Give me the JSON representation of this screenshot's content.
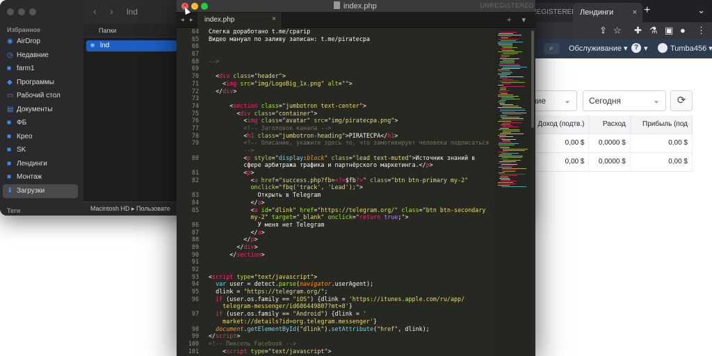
{
  "browser": {
    "tabs": [
      {
        "label": "UNREGISTERED"
      },
      {
        "label": "Лендинги"
      }
    ],
    "new_tab": "+",
    "nav": {
      "search_icon": "search-icon",
      "menu_service": "Обслуживание ▾",
      "help": "?",
      "help_caret": "▾",
      "user": "Tumba456 ▾"
    },
    "filter_period_partial": "ние",
    "filter_date": "Сегодня",
    "refresh_glyph": "⟳",
    "table": {
      "headers": [
        "Доход (подтв.)",
        "Расход",
        "Прибыль (под"
      ],
      "rows": [
        [
          "0,00 $",
          "0,0000 $",
          "0,00 $"
        ],
        [
          "0,00 $",
          "0,0000 $",
          "0,00 $"
        ]
      ]
    }
  },
  "finder": {
    "title": "lnd",
    "sidebar_heading": "Избранное",
    "sidebar_items": [
      "AirDrop",
      "Недавние",
      "farm1",
      "Программы",
      "Рабочий стол",
      "Документы",
      "ФБ",
      "Крео",
      "SK",
      "Лендинги",
      "Монтаж",
      "Загрузки"
    ],
    "tags_heading": "Теги",
    "column_header": "Папки",
    "row": "lnd",
    "path": "Macintosh HD ▸ Пользовате"
  },
  "editor": {
    "title": "index.php",
    "unregistered": "UNREGISTERED",
    "tab_label": "index.php",
    "tab_close": "×",
    "tab_nav": "◂ ▸",
    "tab_controls": "+ ▾",
    "line_numbers": [
      "64",
      "65",
      "66",
      "67",
      "68",
      "69",
      "70",
      "71",
      "72",
      "73",
      "74",
      "75",
      "76",
      "77",
      "78",
      "79",
      "",
      "80",
      "",
      "81",
      "82",
      "",
      "83",
      "84",
      "85",
      "",
      "86",
      "87",
      "88",
      "89",
      "90",
      "91",
      "92",
      "93",
      "94",
      "95",
      "96",
      "",
      "97",
      "",
      "98",
      "99",
      "100",
      "101"
    ]
  }
}
